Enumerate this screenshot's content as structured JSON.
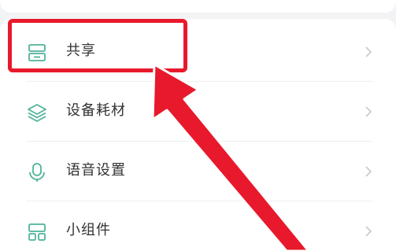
{
  "menu": {
    "items": [
      {
        "label": "共享",
        "icon": "share-box-icon"
      },
      {
        "label": "设备耗材",
        "icon": "layers-icon"
      },
      {
        "label": "语音设置",
        "icon": "microphone-icon"
      },
      {
        "label": "小组件",
        "icon": "widget-icon"
      }
    ]
  },
  "colors": {
    "icon_accent": "#4fb39a",
    "highlight_red": "#e8192c",
    "chevron": "#c8c8c8",
    "label_text": "#333333"
  }
}
